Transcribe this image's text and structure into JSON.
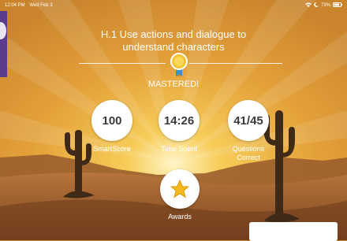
{
  "status_bar": {
    "time": "12:04 PM",
    "date": "Wed Feb 3",
    "battery": "73%"
  },
  "skill": {
    "title_line1": "H.1 Use actions and dialogue to",
    "title_line2": "understand characters"
  },
  "result": {
    "status": "MASTERED!"
  },
  "stats": {
    "smartscore": {
      "value": "100",
      "label": "SmartScore"
    },
    "time_spent": {
      "value": "14:26",
      "label": "Time Spent"
    },
    "questions": {
      "value": "41/45",
      "label_line1": "Questions",
      "label_line2": "Correct"
    }
  },
  "awards": {
    "label": "Awards"
  },
  "colors": {
    "sky": "#e9a93a",
    "sun": "#fff3b8",
    "ground": "#8a5226",
    "cactus": "#3f2a17"
  },
  "icons": {
    "medal": "medal-icon",
    "star": "star-icon"
  }
}
